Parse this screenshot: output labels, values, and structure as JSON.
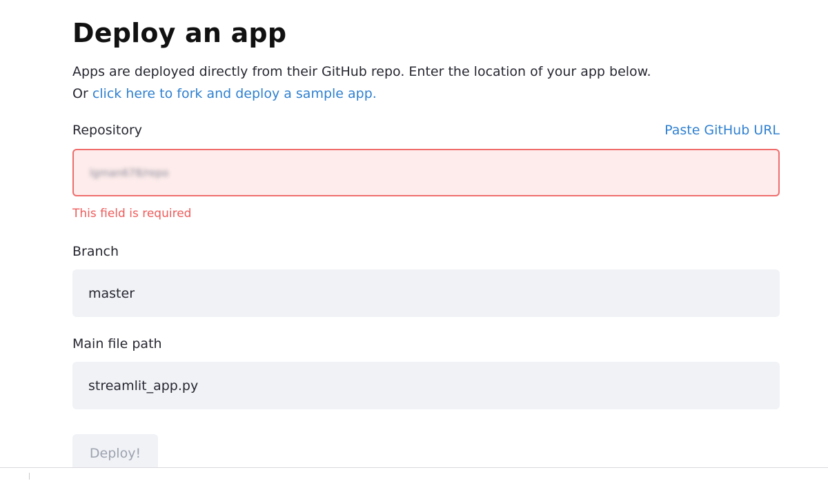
{
  "page": {
    "title": "Deploy an app",
    "intro_line1": "Apps are deployed directly from their GitHub repo. Enter the location of your app below.",
    "intro_prefix": "Or ",
    "intro_link": "click here to fork and deploy a sample app."
  },
  "form": {
    "repository": {
      "label": "Repository",
      "paste_link": "Paste GitHub URL",
      "value": "lgman678/repo",
      "error": "This field is required"
    },
    "branch": {
      "label": "Branch",
      "value": "master"
    },
    "main_file": {
      "label": "Main file path",
      "value": "streamlit_app.py"
    },
    "deploy_label": "Deploy!"
  },
  "colors": {
    "link": "#2f80d0",
    "error": "#ef5a5a",
    "error_border": "#ef6c6b",
    "error_bg": "#fdeceb",
    "field_bg": "#f0f2f6",
    "disabled_text": "#9da2ae"
  }
}
